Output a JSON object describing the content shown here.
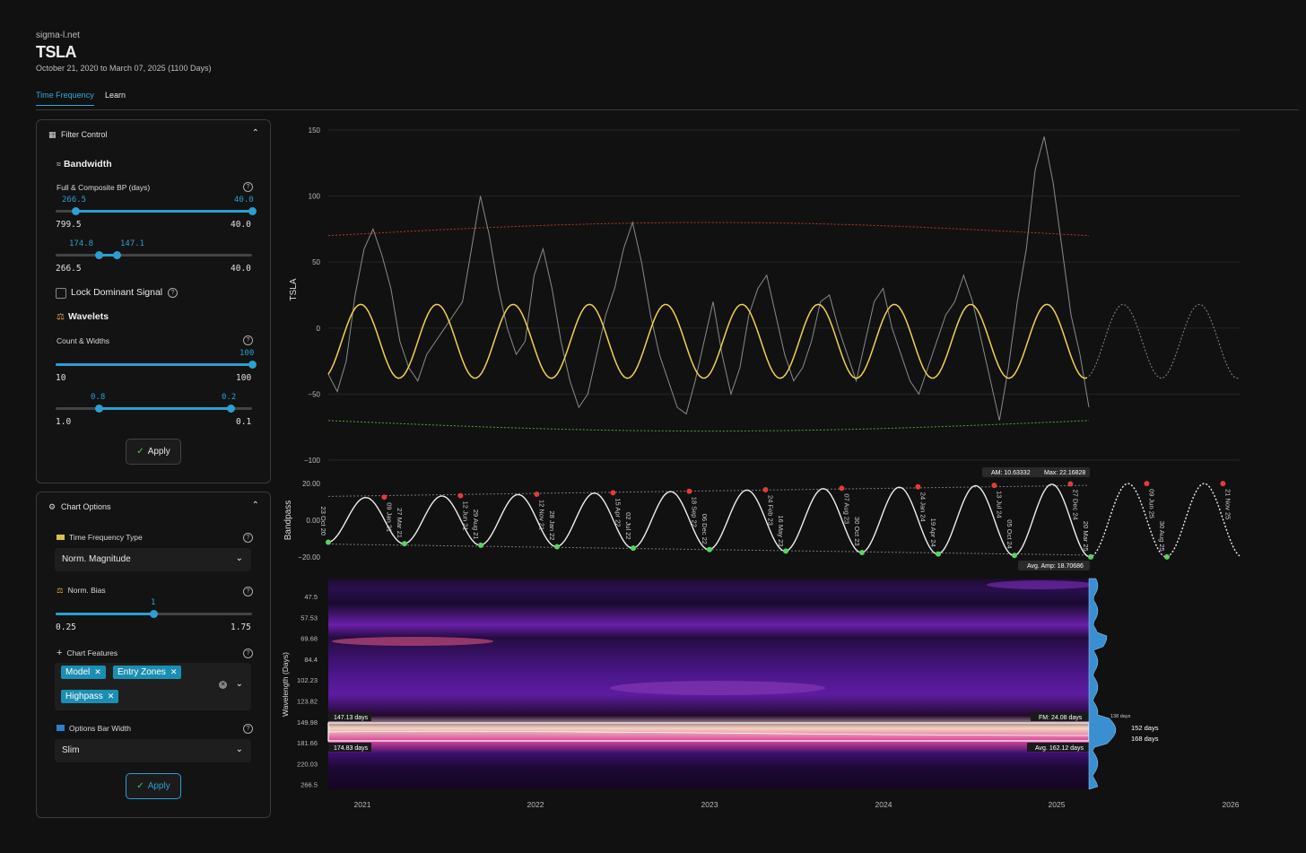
{
  "header": {
    "site": "sigma-l.net",
    "ticker": "TSLA",
    "date_range": "October 21, 2020 to March 07, 2025 (1100 Days)"
  },
  "tabs": [
    {
      "label": "Time Frequency",
      "active": true
    },
    {
      "label": "Learn",
      "active": false
    }
  ],
  "filter_control": {
    "title": "Filter Control",
    "bandwidth": {
      "title": "Bandwidth",
      "label": "Full & Composite BP (days)",
      "slider1": {
        "low": "266.5",
        "high": "40.0",
        "min": "799.5",
        "max": "40.0",
        "low_frac": 0.1,
        "high_frac": 1.0
      },
      "slider2": {
        "low": "174.8",
        "high": "147.1",
        "min": "266.5",
        "max": "40.0",
        "low_frac": 0.35,
        "high_frac": 0.31
      }
    },
    "lock_dominant": {
      "label": "Lock Dominant Signal",
      "checked": false
    },
    "wavelets": {
      "title": "Wavelets",
      "label": "Count & Widths",
      "slider1": {
        "value": "100",
        "min": "10",
        "max": "100",
        "frac": 1.0
      },
      "slider2": {
        "low": "0.8",
        "high": "0.2",
        "min": "1.0",
        "max": "0.1",
        "low_frac": 0.22,
        "high_frac": 0.89
      }
    },
    "apply": "Apply"
  },
  "chart_options": {
    "title": "Chart Options",
    "tf_type": {
      "label": "Time Frequency Type",
      "value": "Norm. Magnitude"
    },
    "norm_bias": {
      "label": "Norm. Bias",
      "value": "1",
      "min": "0.25",
      "max": "1.75",
      "frac": 0.5
    },
    "features": {
      "label": "Chart Features",
      "tags": [
        "Model",
        "Entry Zones",
        "Highpass"
      ]
    },
    "bar_width": {
      "label": "Options Bar Width",
      "value": "Slim"
    },
    "apply": "Apply"
  },
  "colors": {
    "accent": "#2b9fd1",
    "model": "#f2d24b",
    "price": "#8a8a8a",
    "upper": "#b3392e",
    "lower": "#4ea53e",
    "peak": "#e23b3b",
    "trough": "#57d45e"
  },
  "chart_data": [
    {
      "type": "line",
      "ylabel": "TSLA",
      "ylim": [
        -100,
        150
      ],
      "yticks": [
        "150",
        "100",
        "50",
        "0",
        "−50",
        "−100"
      ],
      "series": [
        {
          "values": [
            -35,
            -48,
            -25,
            25,
            60,
            75,
            55,
            30,
            -10,
            -30,
            -40,
            -20,
            -10,
            0,
            10,
            20,
            60,
            100,
            70,
            30,
            0,
            -20,
            -10,
            40,
            60,
            30,
            -10,
            -40,
            -60,
            -50,
            -20,
            10,
            30,
            60,
            80,
            50,
            10,
            -20,
            -40,
            -60,
            -65,
            -40,
            -10,
            20,
            -20,
            -50,
            -30,
            10,
            30,
            40,
            10,
            -20,
            -40,
            -30,
            -10,
            20,
            25,
            0,
            -20,
            -40,
            -10,
            20,
            30,
            0,
            -20,
            -40,
            -50,
            -30,
            -10,
            10,
            20,
            40,
            20,
            -10,
            -40,
            -70,
            -30,
            20,
            60,
            120,
            145,
            110,
            60,
            10,
            -20,
            -60
          ]
        },
        {
          "values": [
            -10,
            10,
            -12,
            12,
            -14,
            14,
            -16,
            17,
            -18,
            19,
            -20,
            21,
            -21,
            21,
            -20,
            20,
            -19,
            19,
            -18,
            18,
            -17,
            18,
            -16,
            -10,
            15,
            -15,
            14
          ]
        }
      ]
    },
    {
      "type": "line",
      "ylabel": "Bandpass",
      "yticks": [
        "20.00",
        "0.00",
        "−20.00"
      ],
      "annotations": [
        "AM: 10.63332",
        "Max: 22.16828",
        "Avg. Amp: 18.70686"
      ],
      "peak_labels": [
        "09 Jan 21",
        "12 Jun 21",
        "12 Nov 21",
        "15 Apr 22",
        "18 Sep 22",
        "24 Feb 23",
        "07 Aug 23",
        "24 Jan 24",
        "13 Jul 24",
        "27 Dec 24",
        "09 Jun 25",
        "21 Nov 25"
      ],
      "trough_labels": [
        "23 Oct 20",
        "27 Mar 21",
        "29 Aug 21",
        "28 Jan 22",
        "02 Jul 22",
        "06 Dec 22",
        "16 May 23",
        "30 Oct 23",
        "19 Apr 24",
        "05 Oct 24",
        "20 Mar 25",
        "30 Aug 25"
      ]
    },
    {
      "type": "heatmap",
      "ylabel": "Wavelength (Days)",
      "yticks": [
        "47.5",
        "57.53",
        "69.68",
        "84.4",
        "102.23",
        "123.82",
        "149.98",
        "181.66",
        "220.03",
        "266.5"
      ],
      "xticks": [
        "2021",
        "2022",
        "2023",
        "2024",
        "2025",
        "2026"
      ],
      "annotations": [
        "147.13 days",
        "174.83 days",
        "FM: 24.08 days",
        "Avg. 162.12 days",
        "138 days",
        "152 days",
        "168 days"
      ]
    }
  ]
}
